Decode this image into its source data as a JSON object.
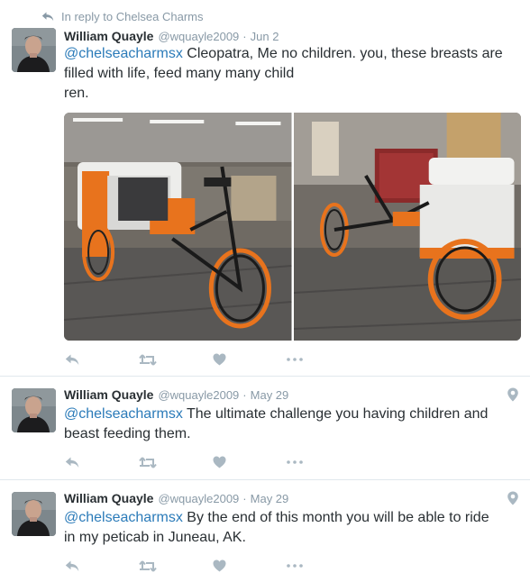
{
  "reply_context": {
    "label": "In reply to Chelsea Charms"
  },
  "tweets": [
    {
      "name": "William Quayle",
      "handle": "@wquayle2009",
      "separator": "·",
      "date": "Jun 2",
      "mention": "@chelseacharmsx",
      "lines": [
        " Cleopatra, Me no children. you, these breasts are",
        "filled with life, feed many many child",
        "ren."
      ],
      "media": [
        "peticab photo, side view",
        "peticab photo, rear view"
      ]
    },
    {
      "name": "William Quayle",
      "handle": "@wquayle2009",
      "separator": "·",
      "date": "May 29",
      "mention": "@chelseacharmsx",
      "lines": [
        " The ultimate challenge you having children and",
        "beast feeding them."
      ]
    },
    {
      "name": "William Quayle",
      "handle": "@wquayle2009",
      "separator": "·",
      "date": "May 29",
      "mention": "@chelseacharmsx",
      "lines": [
        " By the end of this month you will be able to ride",
        "in my peticab in Juneau, AK."
      ]
    }
  ],
  "icons": {
    "reply": "reply-icon",
    "retweet": "retweet-icon",
    "like": "heart-icon",
    "more": "more-icon",
    "location": "location-pin-icon"
  },
  "colors": {
    "text": "#292f33",
    "secondary": "#8899a6",
    "link": "#2b7bb9",
    "action_icon": "#aab8c2",
    "divider": "#e1e8ed",
    "orange": "#e8731d"
  }
}
